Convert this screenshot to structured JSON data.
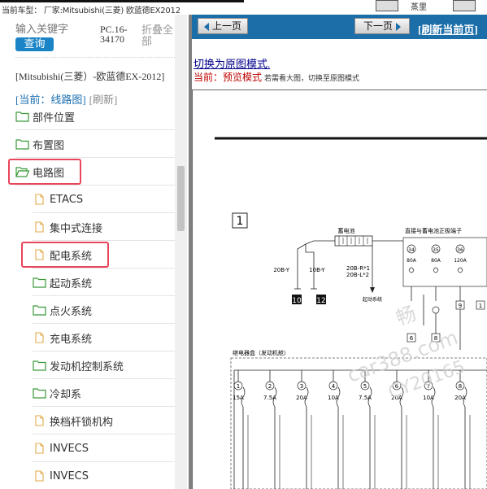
{
  "topbar": {
    "current_model_label": "当前车型： 厂家:Mitsubishi(三菱) 欧蓝德EX2012",
    "right_label": "蒸里"
  },
  "sidebar": {
    "search_placeholder": "输入关键字",
    "search_button": "查询",
    "model_code": "PC.16-34170",
    "collapse_all": "折叠全部",
    "brand_path": "[Mitsubishi(三菱）-欧蓝德EX-2012]",
    "current_label": "[当前：线路图]",
    "refresh_label": "[刷新]",
    "items": [
      {
        "label": "部件位置",
        "icon": "folder-icon"
      },
      {
        "label": "布置图",
        "icon": "folder-icon"
      },
      {
        "label": "电路图",
        "icon": "folder-open-icon"
      },
      {
        "label": "ETACS",
        "icon": "document-icon"
      },
      {
        "label": "集中式连接",
        "icon": "document-icon"
      },
      {
        "label": "配电系统",
        "icon": "document-icon"
      },
      {
        "label": "起动系统",
        "icon": "folder-icon"
      },
      {
        "label": "点火系统",
        "icon": "folder-icon"
      },
      {
        "label": "充电系统",
        "icon": "document-icon"
      },
      {
        "label": "发动机控制系统",
        "icon": "folder-icon"
      },
      {
        "label": "冷却系",
        "icon": "folder-icon"
      },
      {
        "label": "换档杆锁机构",
        "icon": "document-icon"
      },
      {
        "label": "INVECS",
        "icon": "document-icon"
      },
      {
        "label": "INVECS",
        "icon": "document-icon"
      }
    ]
  },
  "main": {
    "prev_button": "上一页",
    "next_button": "下一页",
    "refresh_current": "[刷新当前页]",
    "switch_link": "切换为原图模式.",
    "preview_label": "当前：预览模式",
    "preview_hint": "若需看大图，切换至原图模式"
  },
  "diagram": {
    "box_number": "1",
    "battery_label": "蓄电池",
    "connector_title": "直接与蓄电池正极端子",
    "wire_20B_Y": "20B-Y",
    "wire_10B_Y": "10B-Y",
    "wire_20B_R": "20B-R*1",
    "wire_20B_L": "20B-L*2",
    "ground_10": "10",
    "ground_12": "12",
    "start_system": "起动系统",
    "relay_box_title": "继电器盒（发动机舱）",
    "fuse_top": [
      {
        "num": "34",
        "amp": "80A"
      },
      {
        "num": "35",
        "amp": "80A"
      },
      {
        "num": "36",
        "amp": "120A"
      }
    ],
    "fuse_bottom": [
      {
        "num": "1",
        "amp": "15A"
      },
      {
        "num": "2",
        "amp": "7.5A"
      },
      {
        "num": "3",
        "amp": "20A"
      },
      {
        "num": "4",
        "amp": "10A"
      },
      {
        "num": "5",
        "amp": "7.5A"
      },
      {
        "num": "6",
        "amp": "20A"
      },
      {
        "num": "7",
        "amp": "10A"
      },
      {
        "num": "8",
        "amp": "20A"
      }
    ],
    "connector_numbers": [
      "6",
      "8",
      "9",
      "1"
    ],
    "watermark_line1": "畅",
    "watermark_line2": "car388.com",
    "watermark_line3": "CY20165"
  },
  "colors": {
    "nav_blue": "#1b6ea8",
    "search_blue": "#1b84c7",
    "highlight_red": "#e8465a",
    "preview_red": "#c00000",
    "folder_green": "#3a9a3a",
    "doc_orange": "#e2a94a"
  }
}
